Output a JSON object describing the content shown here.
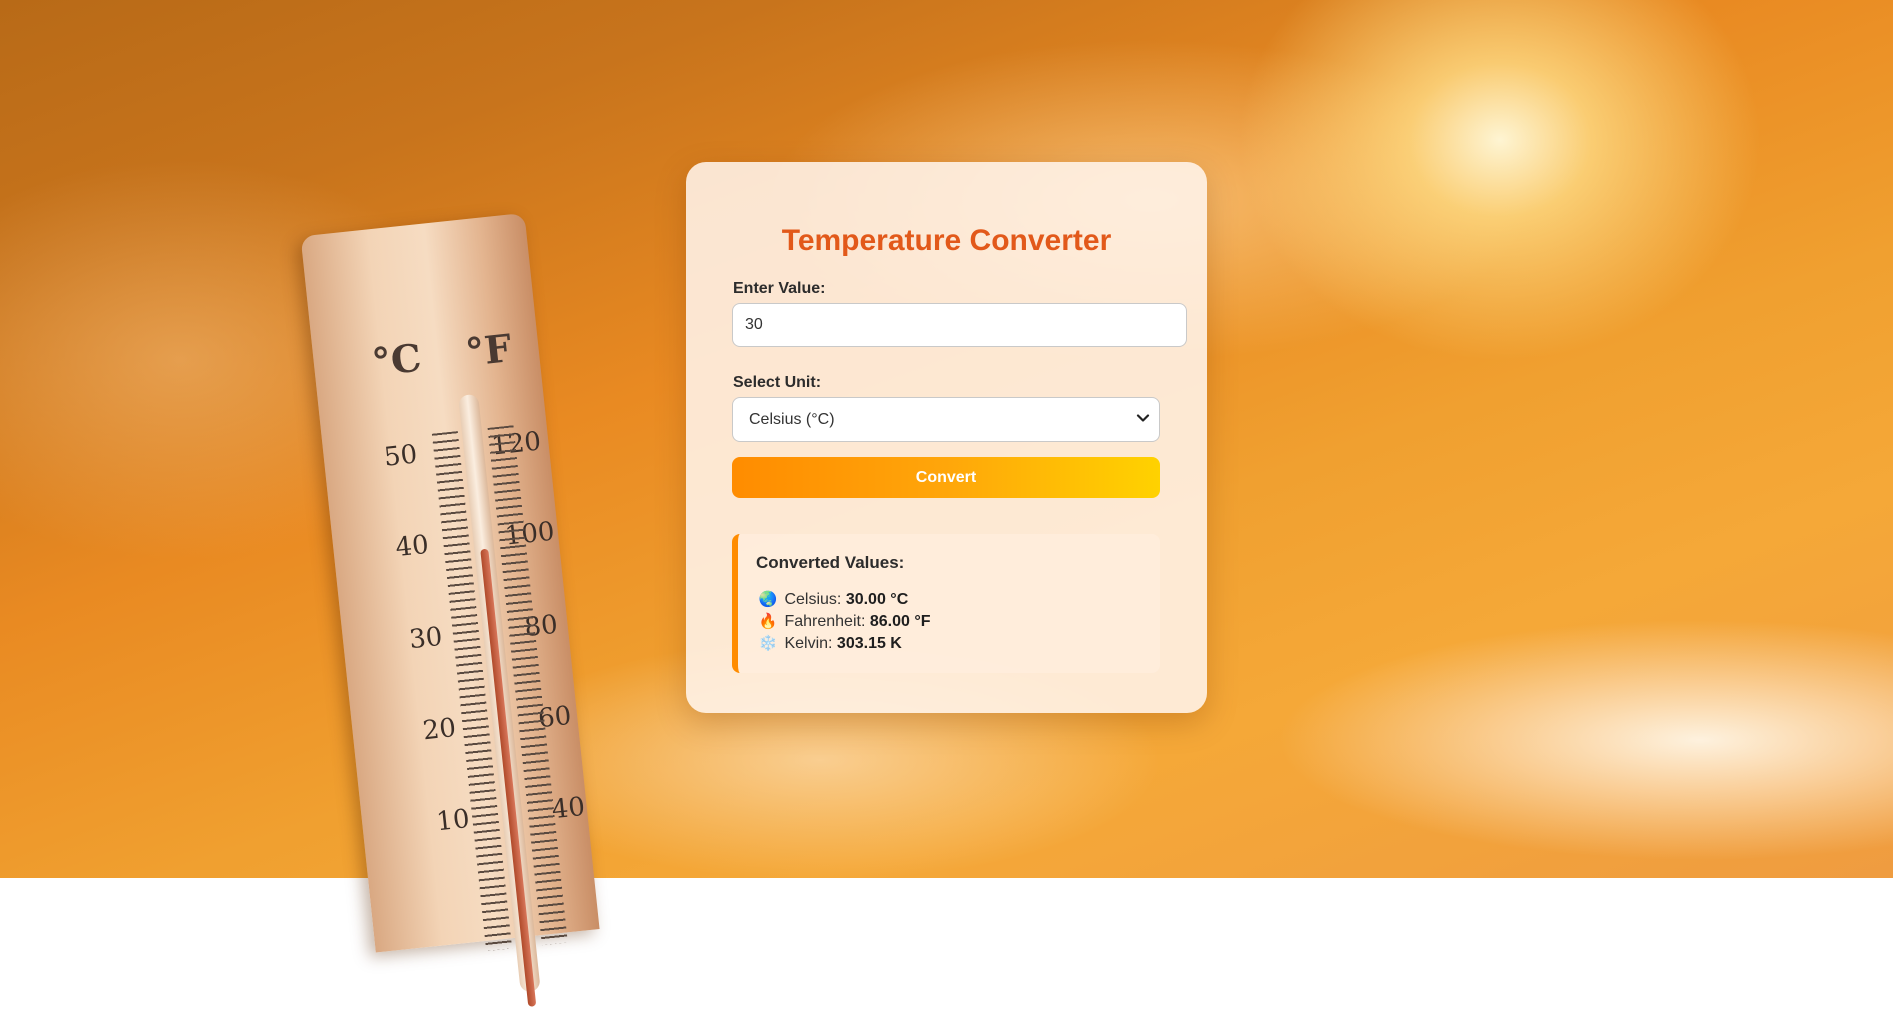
{
  "page": {
    "title": "Temperature Converter"
  },
  "form": {
    "value_label": "Enter Value:",
    "value": "30",
    "unit_label": "Select Unit:",
    "unit_selected": "Celsius (°C)",
    "convert_label": "Convert"
  },
  "results": {
    "heading": "Converted Values:",
    "items": [
      {
        "icon": "globe-icon",
        "emoji": "🌏",
        "label": "Celsius:",
        "value": "30.00 °C"
      },
      {
        "icon": "fire-icon",
        "emoji": "🔥",
        "label": "Fahrenheit:",
        "value": "86.00 °F"
      },
      {
        "icon": "snowflake-icon",
        "emoji": "❄️",
        "label": "Kelvin:",
        "value": "303.15 K"
      }
    ]
  },
  "background": {
    "thermometer": {
      "units": [
        "°C",
        "°F"
      ],
      "celsius_ticks": [
        "50",
        "40",
        "30",
        "20",
        "10"
      ],
      "fahrenheit_ticks": [
        "120",
        "100",
        "80",
        "60",
        "40"
      ]
    }
  },
  "colors": {
    "title": "#e2591a",
    "accent": "#ff8c00",
    "button_gradient_end": "#ffd200"
  }
}
